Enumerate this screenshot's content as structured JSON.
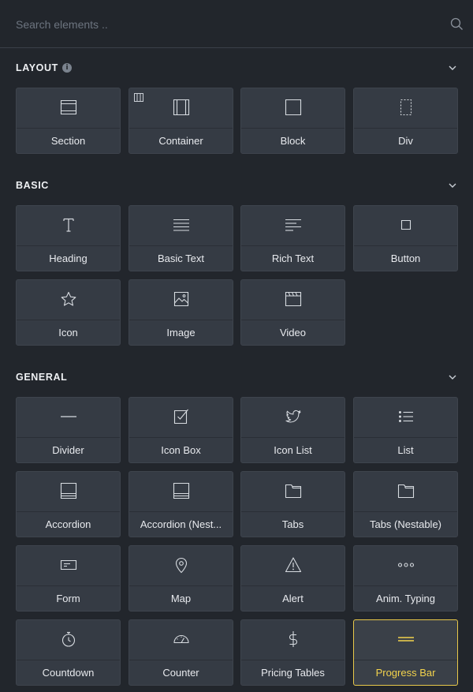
{
  "search": {
    "placeholder": "Search elements .."
  },
  "sections": {
    "layout": {
      "title": "LAYOUT"
    },
    "basic": {
      "title": "BASIC"
    },
    "general": {
      "title": "GENERAL"
    }
  },
  "elements": {
    "section": {
      "label": "Section",
      "icon": "section-icon"
    },
    "container": {
      "label": "Container",
      "icon": "container-icon"
    },
    "block": {
      "label": "Block",
      "icon": "block-icon"
    },
    "div": {
      "label": "Div",
      "icon": "div-icon"
    },
    "heading": {
      "label": "Heading",
      "icon": "heading-icon"
    },
    "basic_text": {
      "label": "Basic Text",
      "icon": "basic-text-icon"
    },
    "rich_text": {
      "label": "Rich Text",
      "icon": "rich-text-icon"
    },
    "button": {
      "label": "Button",
      "icon": "button-icon"
    },
    "icon": {
      "label": "Icon",
      "icon": "star-icon"
    },
    "image": {
      "label": "Image",
      "icon": "image-icon"
    },
    "video": {
      "label": "Video",
      "icon": "video-icon"
    },
    "divider": {
      "label": "Divider",
      "icon": "divider-icon"
    },
    "icon_box": {
      "label": "Icon Box",
      "icon": "icon-box-icon"
    },
    "icon_list": {
      "label": "Icon List",
      "icon": "twitter-icon"
    },
    "list": {
      "label": "List",
      "icon": "list-icon"
    },
    "accordion": {
      "label": "Accordion",
      "icon": "accordion-icon"
    },
    "accordion_nestable": {
      "label": "Accordion (Nest...",
      "icon": "accordion-nestable-icon"
    },
    "tabs": {
      "label": "Tabs",
      "icon": "tabs-icon"
    },
    "tabs_nestable": {
      "label": "Tabs (Nestable)",
      "icon": "tabs-nestable-icon"
    },
    "form": {
      "label": "Form",
      "icon": "form-icon"
    },
    "map": {
      "label": "Map",
      "icon": "map-pin-icon"
    },
    "alert": {
      "label": "Alert",
      "icon": "alert-icon"
    },
    "anim_typing": {
      "label": "Anim. Typing",
      "icon": "dots-icon"
    },
    "countdown": {
      "label": "Countdown",
      "icon": "stopwatch-icon"
    },
    "counter": {
      "label": "Counter",
      "icon": "gauge-icon"
    },
    "pricing_tables": {
      "label": "Pricing Tables",
      "icon": "dollar-icon"
    },
    "progress_bar": {
      "label": "Progress Bar",
      "icon": "progress-bar-icon",
      "active": true
    }
  },
  "colors": {
    "background": "#22262c",
    "tile": "#353b44",
    "accent": "#e8c84a"
  }
}
